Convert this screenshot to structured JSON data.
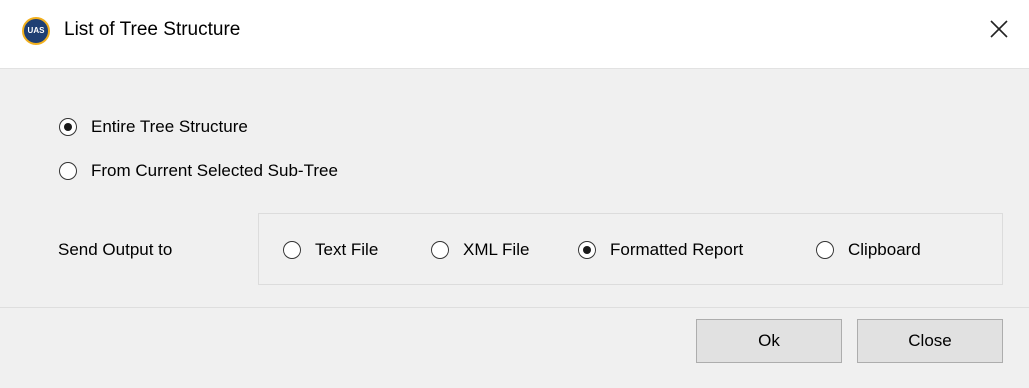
{
  "window": {
    "title": "List of Tree Structure",
    "app_icon_text": "UAS",
    "icon": "close-icon"
  },
  "scope": {
    "options": [
      {
        "label": "Entire Tree Structure",
        "checked": true
      },
      {
        "label": "From Current Selected Sub-Tree",
        "checked": false
      }
    ]
  },
  "output": {
    "label": "Send Output to",
    "options": [
      {
        "label": "Text File",
        "checked": false
      },
      {
        "label": "XML File",
        "checked": false
      },
      {
        "label": "Formatted Report",
        "checked": true
      },
      {
        "label": "Clipboard",
        "checked": false
      }
    ]
  },
  "buttons": {
    "ok": "Ok",
    "close": "Close"
  },
  "colors": {
    "titlebar": "#ffffff",
    "dialog_background": "#f0f0f0",
    "button_background": "#e1e1e1",
    "app_icon_blue": "#1f3f73",
    "app_icon_gold": "#f2b01e"
  }
}
